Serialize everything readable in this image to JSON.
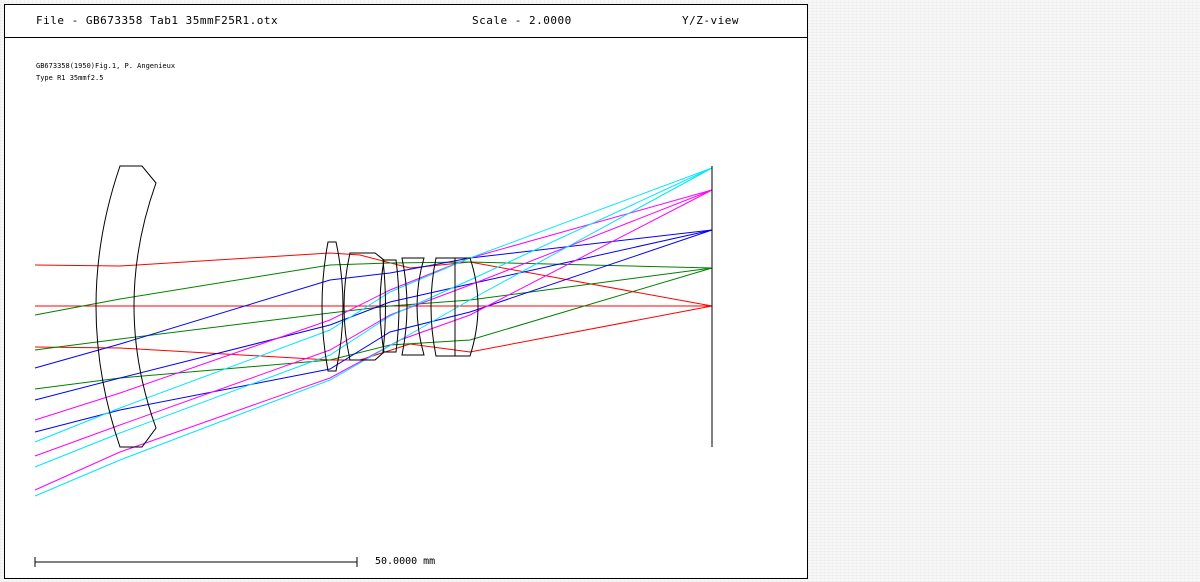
{
  "header": {
    "file": "File - GB673358 Tab1 35mmF25R1.otx",
    "scale": "Scale - 2.0000",
    "view": "Y/Z-view"
  },
  "description": {
    "line1": "GB673358(1950)Fig.1, P. Angenieux",
    "line2": "Type R1 35mmf2.5"
  },
  "scale_bar": {
    "label": "50.0000 mm"
  },
  "colors": {
    "lens": "#000000",
    "ray_red": "#ff0000",
    "ray_green": "#008000",
    "ray_blue": "#0000ff",
    "ray_magenta": "#ff00ff",
    "ray_cyan": "#00e5ff"
  }
}
